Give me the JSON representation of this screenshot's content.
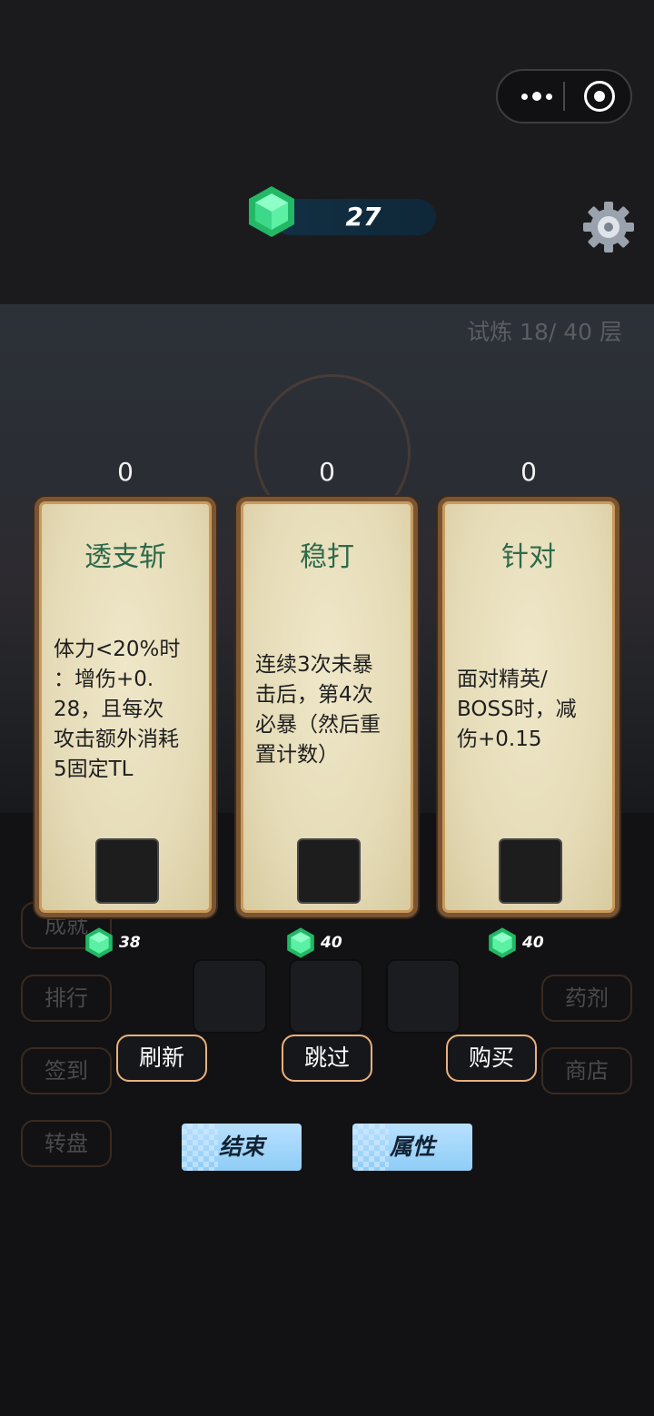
{
  "header": {
    "gem_count": "27",
    "capsule_more_icon": "more-dots-icon",
    "capsule_close_icon": "target-circle-icon",
    "settings_icon": "gear-icon"
  },
  "scene": {
    "trial_label": "试炼 18/ 40 层"
  },
  "cards": [
    {
      "count": "0",
      "title": "透支斩",
      "desc": "体力<20%时：增伤+0.28，且每次攻击额外消耗5固定TL",
      "lines": [
        "体力<20%时",
        "：增伤+0.",
        "28，且每次",
        "攻击额外消耗",
        "5固定TL"
      ],
      "price": "38"
    },
    {
      "count": "0",
      "title": "稳打",
      "desc": "连续3次未暴击后，第4次必暴（然后重置计数）",
      "lines": [
        "连续3次未暴",
        "击后，第4次",
        "必暴（然后重",
        "置计数）"
      ],
      "price": "40"
    },
    {
      "count": "0",
      "title": "针对",
      "desc": "面对精英/BOSS时，减伤+0.15",
      "lines": [
        "面对精英/",
        "BOSS时，减",
        "伤+0.15"
      ],
      "price": "40"
    }
  ],
  "left_menu": [
    "成就",
    "排行",
    "签到",
    "转盘"
  ],
  "right_menu": [
    "药剂",
    "商店"
  ],
  "actions": {
    "refresh": "刷新",
    "skip": "跳过",
    "buy": "购买"
  },
  "bottom": {
    "end": "结束",
    "attributes": "属性"
  },
  "colors": {
    "card_title": "#2e6a4a",
    "gem": "#3fd68a",
    "action_border": "#e9b07a",
    "blue_button": "#9fd4fa"
  }
}
